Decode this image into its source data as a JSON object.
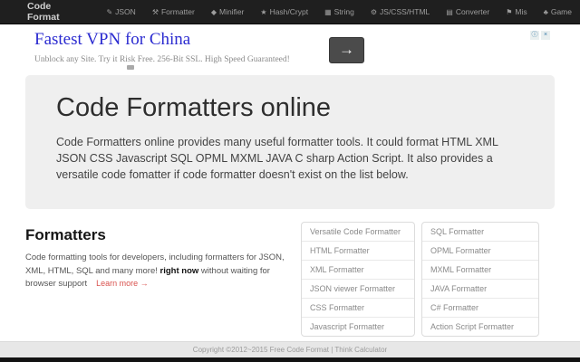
{
  "navbar": {
    "brand": "Code Format",
    "items": [
      {
        "label": "JSON",
        "icon": "pencil-icon",
        "glyph": "✎"
      },
      {
        "label": "Formatter",
        "icon": "wrench-icon",
        "glyph": "⚒"
      },
      {
        "label": "Minifier",
        "icon": "tags-icon",
        "glyph": "◆"
      },
      {
        "label": "Hash/Crypt",
        "icon": "star-icon",
        "glyph": "★"
      },
      {
        "label": "String",
        "icon": "table-icon",
        "glyph": "▦"
      },
      {
        "label": "JS/CSS/HTML",
        "icon": "gear-icon",
        "glyph": "⚙"
      },
      {
        "label": "Converter",
        "icon": "list-icon",
        "glyph": "▤"
      },
      {
        "label": "Mis",
        "icon": "flag-icon",
        "glyph": "⚑"
      },
      {
        "label": "Game",
        "icon": "tree-icon",
        "glyph": "♣"
      }
    ]
  },
  "ad": {
    "title": "Fastest VPN for China",
    "subtitle": "Unblock any Site. Try it Risk Free. 256-Bit SSL. High Speed Guaranteed!",
    "arrow_glyph": "→",
    "info_glyph": "ⓘ",
    "close_glyph": "×"
  },
  "jumbotron": {
    "title": "Code Formatters online",
    "description": "Code Formatters online provides many useful formatter tools. It could format HTML XML JSON CSS Javascript SQL OPML MXML JAVA C sharp Action Script. It also provides a versatile code fomatter if code formatter doesn't exist on the list below."
  },
  "formatters": {
    "heading": "Formatters",
    "desc_before": "Code formatting tools for developers, including formatters for JSON, XML, HTML, SQL and many more! ",
    "desc_bold": "right now",
    "desc_after": " without waiting for browser support",
    "learn_more": "Learn more →",
    "list_left": [
      "Versatile Code Formatter",
      "HTML Formatter",
      "XML Formatter",
      "JSON viewer Formatter",
      "CSS Formatter",
      "Javascript Formatter"
    ],
    "list_right": [
      "SQL Formatter",
      "OPML Formatter",
      "MXML Formatter",
      "JAVA Formatter",
      "C# Formatter",
      "Action Script Formatter"
    ]
  },
  "footer": {
    "copyright": "Copyright ©2012~2015 Free Code Format | Think Calculator"
  },
  "colors": {
    "navbar_bg": "#1f1f1f",
    "nav_link": "#9d9d9d",
    "ad_title_blue": "#2b2bd0",
    "jumbotron_bg": "#efefef",
    "learn_more_red": "#d9534f",
    "footer_bg": "#e7e7e7"
  }
}
